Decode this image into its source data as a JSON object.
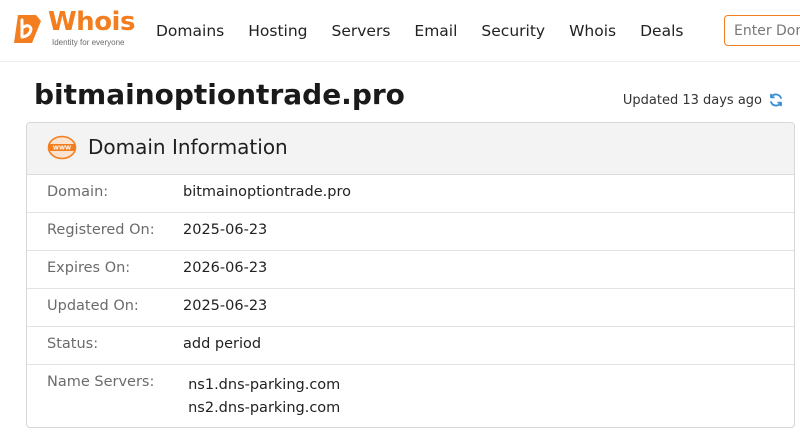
{
  "brand": {
    "name": "Whois",
    "tagline": "Identity for everyone",
    "accent_color": "#f27e1f"
  },
  "nav": {
    "items": [
      "Domains",
      "Hosting",
      "Servers",
      "Email",
      "Security",
      "Whois",
      "Deals"
    ]
  },
  "search": {
    "placeholder": "Enter Domain or IP"
  },
  "page": {
    "domain": "bitmainoptiontrade.pro",
    "updated": "Updated 13 days ago"
  },
  "card": {
    "title": "Domain Information",
    "icon": "www-icon",
    "rows": [
      {
        "label": "Domain:",
        "value": "bitmainoptiontrade.pro"
      },
      {
        "label": "Registered On:",
        "value": "2025-06-23"
      },
      {
        "label": "Expires On:",
        "value": "2026-06-23"
      },
      {
        "label": "Updated On:",
        "value": "2025-06-23"
      },
      {
        "label": "Status:",
        "value": "add period"
      },
      {
        "label": "Name Servers:",
        "values": [
          "ns1.dns-parking.com",
          "ns2.dns-parking.com"
        ]
      }
    ]
  }
}
